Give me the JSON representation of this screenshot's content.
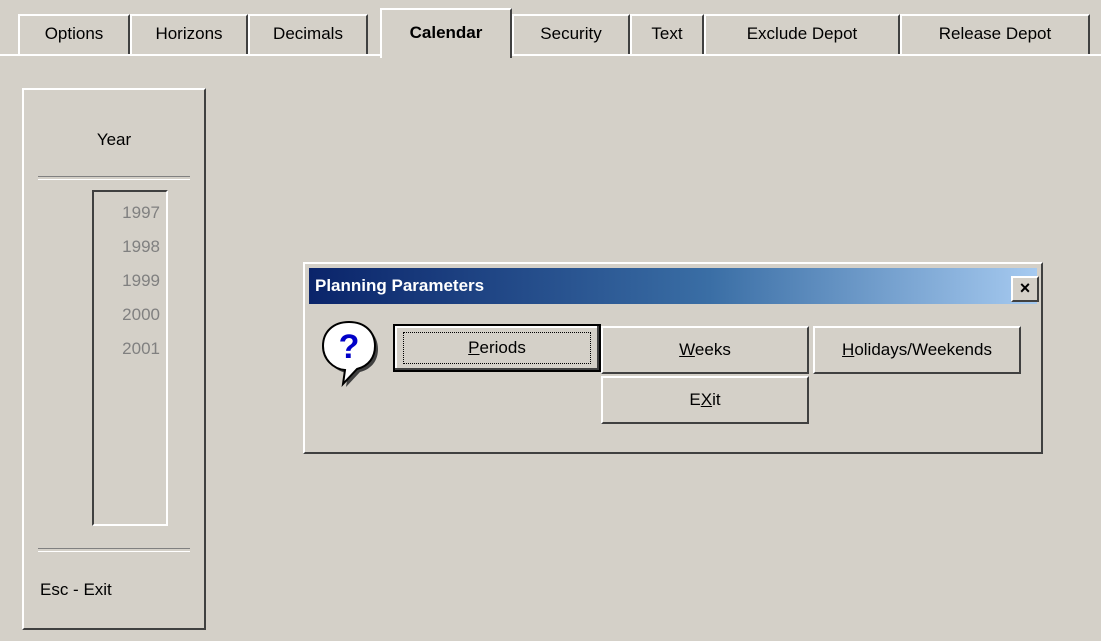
{
  "tabs": [
    {
      "label": "Options",
      "active": false
    },
    {
      "label": "Horizons",
      "active": false
    },
    {
      "label": "Decimals",
      "active": false
    },
    {
      "label": "Calendar",
      "active": true
    },
    {
      "label": "Security",
      "active": false
    },
    {
      "label": "Text",
      "active": false
    },
    {
      "label": "Exclude Depot",
      "active": false
    },
    {
      "label": "Release Depot",
      "active": false
    }
  ],
  "year_panel": {
    "title": "Year",
    "years": [
      "1997",
      "1998",
      "1999",
      "2000",
      "2001"
    ],
    "footer": "Esc - Exit"
  },
  "dialog": {
    "title": "Planning Parameters",
    "close_label": "×",
    "icon": "question-mark-icon",
    "buttons": {
      "periods": {
        "label": "Periods",
        "hotkey": "P"
      },
      "weeks": {
        "label": "Weeks",
        "hotkey": "W"
      },
      "holidays": {
        "label": "Holidays/Weekends",
        "hotkey": "H"
      },
      "exit": {
        "label": "EXit",
        "hotkey": "X"
      }
    }
  },
  "colors": {
    "face": "#d4d0c8",
    "title_start": "#0a246a",
    "title_end": "#a6caf0",
    "disabled_text": "#808080"
  }
}
